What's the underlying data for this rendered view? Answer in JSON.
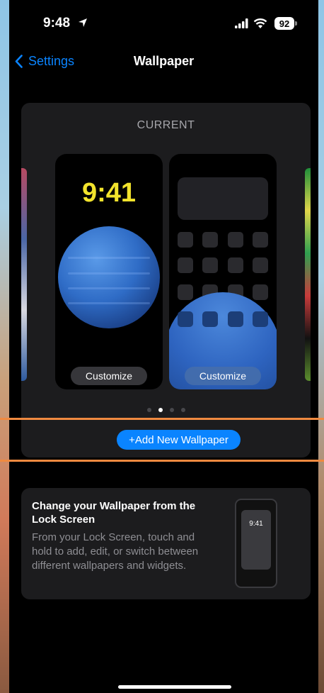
{
  "status_bar": {
    "time": "9:48",
    "battery": "92"
  },
  "nav": {
    "back_label": "Settings",
    "title": "Wallpaper"
  },
  "wallpaper_card": {
    "section_label": "CURRENT",
    "lock_time": "9:41",
    "lock_customize_label": "Customize",
    "home_customize_label": "Customize",
    "page_count": 4,
    "active_page": 2,
    "add_button_label": "+Add New Wallpaper"
  },
  "info_card": {
    "title": "Change your Wallpaper from the Lock Screen",
    "body": "From your Lock Screen, touch and hold to add, edit, or switch between different wallpapers and widgets.",
    "mini_time": "9:41"
  },
  "colors": {
    "accent": "#0a84ff",
    "lock_time": "#f2e32c",
    "highlight_line": "#f08a40"
  }
}
